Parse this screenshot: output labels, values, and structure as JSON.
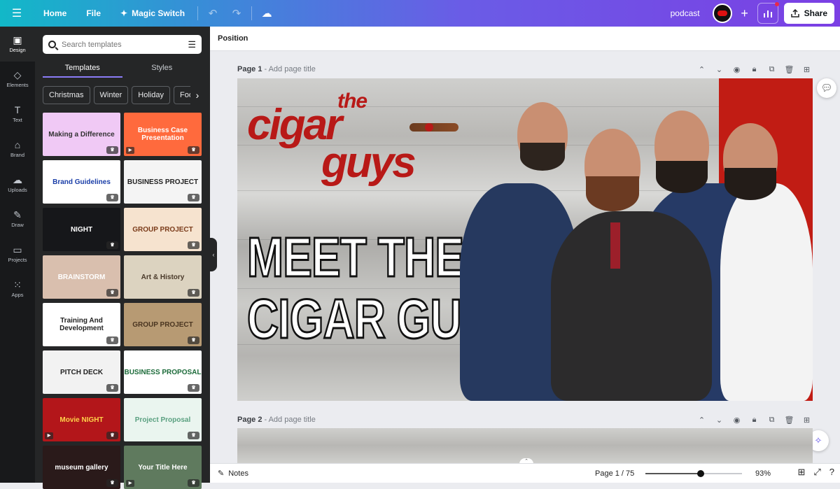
{
  "topbar": {
    "home": "Home",
    "file": "File",
    "magic_switch": "Magic Switch",
    "design_name": "podcast",
    "share": "Share"
  },
  "rail": [
    {
      "label": "Design",
      "icon": "layout-icon"
    },
    {
      "label": "Elements",
      "icon": "shapes-icon"
    },
    {
      "label": "Text",
      "icon": "text-icon"
    },
    {
      "label": "Brand",
      "icon": "brand-icon"
    },
    {
      "label": "Uploads",
      "icon": "cloud-upload-icon"
    },
    {
      "label": "Draw",
      "icon": "pen-icon"
    },
    {
      "label": "Projects",
      "icon": "folder-icon"
    },
    {
      "label": "Apps",
      "icon": "apps-grid-icon"
    }
  ],
  "panel": {
    "search_placeholder": "Search templates",
    "tabs": [
      "Templates",
      "Styles"
    ],
    "chips": [
      "Christmas",
      "Winter",
      "Holiday",
      "Food"
    ],
    "templates": [
      {
        "title": "Making a Difference",
        "bg": "#f0c9f5",
        "fg": "#333"
      },
      {
        "title": "Business Case Presentation",
        "bg": "#ff6a3d",
        "fg": "#fff"
      },
      {
        "title": "Brand Guidelines",
        "bg": "#ffffff",
        "fg": "#1a3ea8"
      },
      {
        "title": "BUSINESS PROJECT",
        "bg": "#f4f4f4",
        "fg": "#222"
      },
      {
        "title": "NIGHT",
        "bg": "#16171a",
        "fg": "#fff"
      },
      {
        "title": "GROUP PROJECT",
        "bg": "#f6e3cf",
        "fg": "#7a3b1a"
      },
      {
        "title": "BRAINSTORM",
        "bg": "#d9bfae",
        "fg": "#fff"
      },
      {
        "title": "Art & History",
        "bg": "#dcd3c0",
        "fg": "#4a3a2a"
      },
      {
        "title": "Training And Development",
        "bg": "#ffffff",
        "fg": "#222"
      },
      {
        "title": "GROUP PROJECT",
        "bg": "#b79a73",
        "fg": "#4a3520"
      },
      {
        "title": "PITCH DECK",
        "bg": "#f2f2f2",
        "fg": "#222"
      },
      {
        "title": "BUSINESS PROPOSAL",
        "bg": "#ffffff",
        "fg": "#1c6b3a"
      },
      {
        "title": "Movie NIGHT",
        "bg": "#b3161a",
        "fg": "#ffd24a"
      },
      {
        "title": "Project Proposal",
        "bg": "#eaf5ef",
        "fg": "#5aa080"
      },
      {
        "title": "museum gallery",
        "bg": "#2a1a1a",
        "fg": "#fff"
      },
      {
        "title": "Your Title Here",
        "bg": "#5f7a5e",
        "fg": "#fff"
      }
    ]
  },
  "context_bar": {
    "label": "Position"
  },
  "canvas": {
    "page1_label": "Page 1",
    "page1_sub": "- Add page title",
    "page2_label": "Page 2",
    "page2_sub": "- Add page title",
    "design": {
      "the": "the",
      "cigar": "cigar",
      "guys": "guys",
      "headline_line1": "MEET THE",
      "headline_line2": "CIGAR GUYS"
    }
  },
  "bottombar": {
    "notes": "Notes",
    "page_info": "Page 1 / 75",
    "zoom": "93%",
    "zoom_fraction": 0.57
  }
}
